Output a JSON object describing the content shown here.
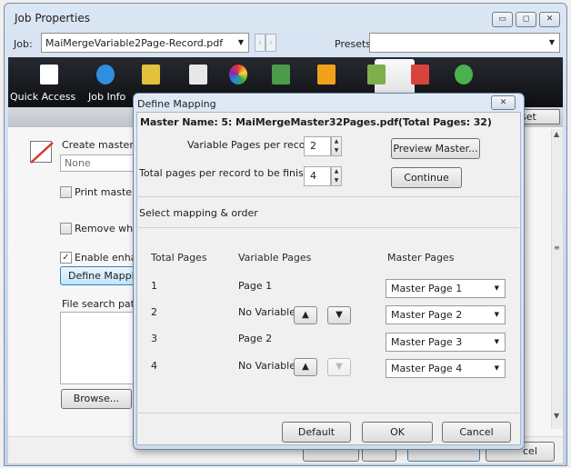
{
  "window": {
    "title": "Job Properties",
    "minimize_glyph": "▭",
    "maximize_glyph": "◻",
    "close_glyph": "✕"
  },
  "header": {
    "job_label": "Job:",
    "job_value": "MaiMergeVariable2Page-Record.pdf",
    "nav_prev": "‹",
    "nav_next": "›",
    "presets_label": "Presets:",
    "presets_value": "",
    "dropdown_glyph": "▼"
  },
  "toolbar": {
    "items": [
      {
        "label": "Quick Access",
        "icon": "quick-access-icon",
        "color": "#ffffff"
      },
      {
        "label": "Job Info",
        "icon": "info-icon",
        "color": "#2f8fe0"
      },
      {
        "label": "",
        "icon": "stack-icon",
        "color": "#e2c23a"
      },
      {
        "label": "",
        "icon": "document-icon",
        "color": "#e8e8e8"
      },
      {
        "label": "",
        "icon": "color-wheel-icon",
        "color": "#d63a7a"
      },
      {
        "label": "",
        "icon": "image-icon",
        "color": "#4d9a4a"
      },
      {
        "label": "",
        "icon": "book-icon",
        "color": "#f0a21d"
      },
      {
        "label": "",
        "icon": "variable-data-icon",
        "color": "#7fae4c"
      },
      {
        "label": "",
        "icon": "stamp-icon",
        "color": "#d8443c"
      },
      {
        "label": "",
        "icon": "check-icon",
        "color": "#4caf50"
      }
    ]
  },
  "background": {
    "reset_label": "set",
    "create_master_label": "Create master:",
    "create_master_value": "None",
    "print_master_label": "Print master",
    "remove_white_label": "Remove white",
    "enable_enhance_label": "Enable enhanc",
    "define_mapping_label": "Define Mappin",
    "file_search_label": "File search path:",
    "browse_label": "Browse...",
    "cancel_label": "cel",
    "scroll_up": "▲",
    "scroll_down": "▼",
    "scroll_grip": "≡",
    "check_glyph": "✓"
  },
  "dialog": {
    "title": "Define Mapping",
    "close_glyph": "✕",
    "master_name": "Master Name: 5: MaiMergeMaster32Pages.pdf(Total Pages: 32)",
    "variable_pages_label": "Variable Pages per record:",
    "variable_pages_value": "2",
    "total_pages_label": "Total pages per record to be finished:",
    "total_pages_value": "4",
    "spin_up": "▲",
    "spin_down": "▼",
    "preview_master_label": "Preview Master...",
    "continue_label": "Continue",
    "select_mapping_label": "Select mapping & order",
    "columns": {
      "total_pages": "Total Pages",
      "variable_pages": "Variable Pages",
      "master_pages": "Master Pages"
    },
    "up_glyph": "▲",
    "down_glyph": "▼",
    "rows": [
      {
        "total": "1",
        "variable": "Page 1",
        "master": "Master Page 1"
      },
      {
        "total": "2",
        "variable": "No Variable",
        "master": "Master Page 2"
      },
      {
        "total": "3",
        "variable": "Page 2",
        "master": "Master Page 3"
      },
      {
        "total": "4",
        "variable": "No Variable",
        "master": "Master Page 4"
      }
    ],
    "default_label": "Default",
    "ok_label": "OK",
    "cancel_label": "Cancel"
  }
}
